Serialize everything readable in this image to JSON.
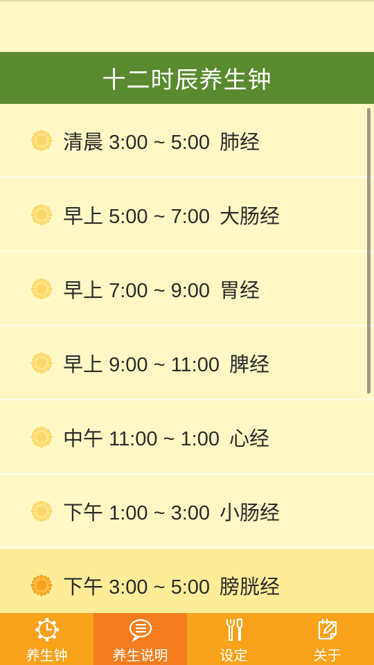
{
  "header": {
    "title": "十二时辰养生钟"
  },
  "schedule": {
    "items": [
      {
        "period": "清晨",
        "time": "3:00 ~ 5:00",
        "meridian": "肺经",
        "highlighted": false
      },
      {
        "period": "早上",
        "time": "5:00 ~ 7:00",
        "meridian": "大肠经",
        "highlighted": false
      },
      {
        "period": "早上",
        "time": "7:00 ~ 9:00",
        "meridian": "胃经",
        "highlighted": false
      },
      {
        "period": "早上",
        "time": "9:00 ~ 11:00",
        "meridian": "脾经",
        "highlighted": false
      },
      {
        "period": "中午",
        "time": "11:00 ~ 1:00",
        "meridian": "心经",
        "highlighted": false
      },
      {
        "period": "下午",
        "time": "1:00 ~ 3:00",
        "meridian": "小肠经",
        "highlighted": false
      },
      {
        "period": "下午",
        "time": "3:00 ~ 5:00",
        "meridian": "膀胱经",
        "highlighted": true
      }
    ],
    "icon": "sun-icon"
  },
  "tabbar": {
    "tabs": [
      {
        "label": "养生钟",
        "icon": "clock-icon",
        "active": false
      },
      {
        "label": "养生说明",
        "icon": "chat-list-icon",
        "active": true
      },
      {
        "label": "设定",
        "icon": "tools-icon",
        "active": false
      },
      {
        "label": "关于",
        "icon": "edit-note-icon",
        "active": false
      }
    ]
  },
  "colors": {
    "background": "#fff8c6",
    "title_bar": "#5a8a2f",
    "highlight_row": "#ffec99",
    "tabbar": "#f9a21b",
    "tab_active": "#f47d20",
    "sun": "#fcd868",
    "sun_active": "#f9a21b"
  }
}
